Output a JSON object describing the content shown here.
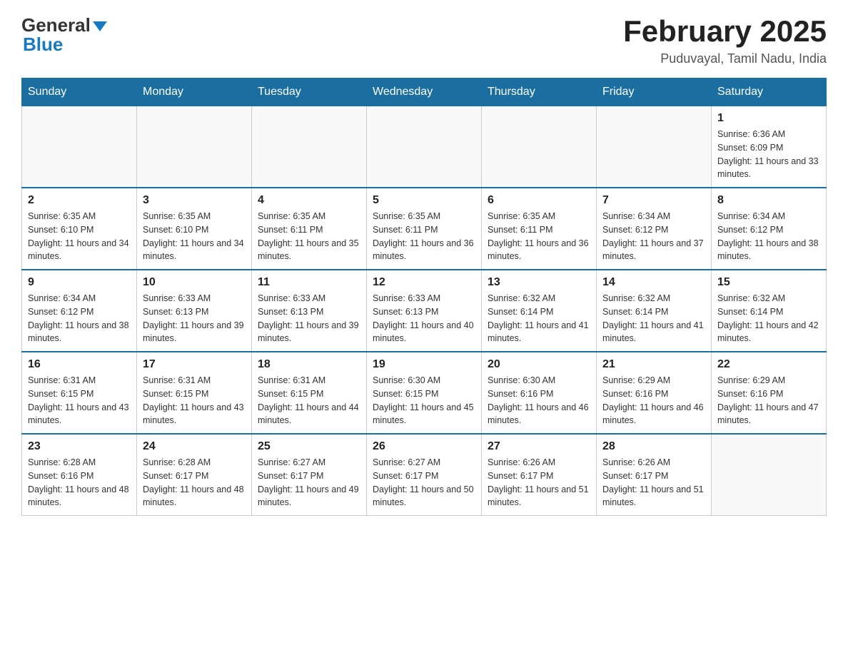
{
  "logo": {
    "general": "General",
    "blue": "Blue"
  },
  "header": {
    "month_year": "February 2025",
    "location": "Puduvayal, Tamil Nadu, India"
  },
  "days_of_week": [
    "Sunday",
    "Monday",
    "Tuesday",
    "Wednesday",
    "Thursday",
    "Friday",
    "Saturday"
  ],
  "weeks": [
    [
      {
        "num": "",
        "info": ""
      },
      {
        "num": "",
        "info": ""
      },
      {
        "num": "",
        "info": ""
      },
      {
        "num": "",
        "info": ""
      },
      {
        "num": "",
        "info": ""
      },
      {
        "num": "",
        "info": ""
      },
      {
        "num": "1",
        "info": "Sunrise: 6:36 AM\nSunset: 6:09 PM\nDaylight: 11 hours and 33 minutes."
      }
    ],
    [
      {
        "num": "2",
        "info": "Sunrise: 6:35 AM\nSunset: 6:10 PM\nDaylight: 11 hours and 34 minutes."
      },
      {
        "num": "3",
        "info": "Sunrise: 6:35 AM\nSunset: 6:10 PM\nDaylight: 11 hours and 34 minutes."
      },
      {
        "num": "4",
        "info": "Sunrise: 6:35 AM\nSunset: 6:11 PM\nDaylight: 11 hours and 35 minutes."
      },
      {
        "num": "5",
        "info": "Sunrise: 6:35 AM\nSunset: 6:11 PM\nDaylight: 11 hours and 36 minutes."
      },
      {
        "num": "6",
        "info": "Sunrise: 6:35 AM\nSunset: 6:11 PM\nDaylight: 11 hours and 36 minutes."
      },
      {
        "num": "7",
        "info": "Sunrise: 6:34 AM\nSunset: 6:12 PM\nDaylight: 11 hours and 37 minutes."
      },
      {
        "num": "8",
        "info": "Sunrise: 6:34 AM\nSunset: 6:12 PM\nDaylight: 11 hours and 38 minutes."
      }
    ],
    [
      {
        "num": "9",
        "info": "Sunrise: 6:34 AM\nSunset: 6:12 PM\nDaylight: 11 hours and 38 minutes."
      },
      {
        "num": "10",
        "info": "Sunrise: 6:33 AM\nSunset: 6:13 PM\nDaylight: 11 hours and 39 minutes."
      },
      {
        "num": "11",
        "info": "Sunrise: 6:33 AM\nSunset: 6:13 PM\nDaylight: 11 hours and 39 minutes."
      },
      {
        "num": "12",
        "info": "Sunrise: 6:33 AM\nSunset: 6:13 PM\nDaylight: 11 hours and 40 minutes."
      },
      {
        "num": "13",
        "info": "Sunrise: 6:32 AM\nSunset: 6:14 PM\nDaylight: 11 hours and 41 minutes."
      },
      {
        "num": "14",
        "info": "Sunrise: 6:32 AM\nSunset: 6:14 PM\nDaylight: 11 hours and 41 minutes."
      },
      {
        "num": "15",
        "info": "Sunrise: 6:32 AM\nSunset: 6:14 PM\nDaylight: 11 hours and 42 minutes."
      }
    ],
    [
      {
        "num": "16",
        "info": "Sunrise: 6:31 AM\nSunset: 6:15 PM\nDaylight: 11 hours and 43 minutes."
      },
      {
        "num": "17",
        "info": "Sunrise: 6:31 AM\nSunset: 6:15 PM\nDaylight: 11 hours and 43 minutes."
      },
      {
        "num": "18",
        "info": "Sunrise: 6:31 AM\nSunset: 6:15 PM\nDaylight: 11 hours and 44 minutes."
      },
      {
        "num": "19",
        "info": "Sunrise: 6:30 AM\nSunset: 6:15 PM\nDaylight: 11 hours and 45 minutes."
      },
      {
        "num": "20",
        "info": "Sunrise: 6:30 AM\nSunset: 6:16 PM\nDaylight: 11 hours and 46 minutes."
      },
      {
        "num": "21",
        "info": "Sunrise: 6:29 AM\nSunset: 6:16 PM\nDaylight: 11 hours and 46 minutes."
      },
      {
        "num": "22",
        "info": "Sunrise: 6:29 AM\nSunset: 6:16 PM\nDaylight: 11 hours and 47 minutes."
      }
    ],
    [
      {
        "num": "23",
        "info": "Sunrise: 6:28 AM\nSunset: 6:16 PM\nDaylight: 11 hours and 48 minutes."
      },
      {
        "num": "24",
        "info": "Sunrise: 6:28 AM\nSunset: 6:17 PM\nDaylight: 11 hours and 48 minutes."
      },
      {
        "num": "25",
        "info": "Sunrise: 6:27 AM\nSunset: 6:17 PM\nDaylight: 11 hours and 49 minutes."
      },
      {
        "num": "26",
        "info": "Sunrise: 6:27 AM\nSunset: 6:17 PM\nDaylight: 11 hours and 50 minutes."
      },
      {
        "num": "27",
        "info": "Sunrise: 6:26 AM\nSunset: 6:17 PM\nDaylight: 11 hours and 51 minutes."
      },
      {
        "num": "28",
        "info": "Sunrise: 6:26 AM\nSunset: 6:17 PM\nDaylight: 11 hours and 51 minutes."
      },
      {
        "num": "",
        "info": ""
      }
    ]
  ]
}
